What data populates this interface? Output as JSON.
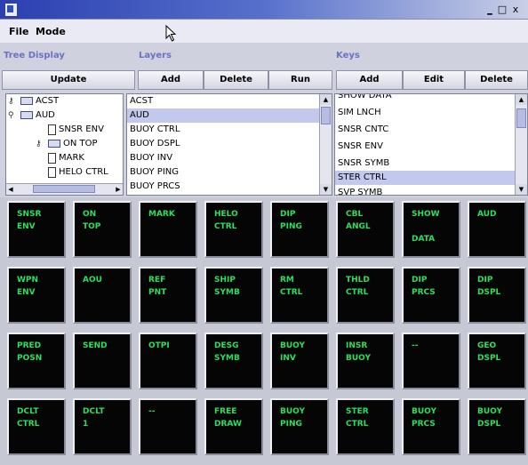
{
  "window": {
    "controls": {
      "minimize": "_",
      "maximize": "□",
      "close": "x"
    }
  },
  "menu": {
    "items": [
      "File",
      "Mode"
    ]
  },
  "sections": {
    "tree": "Tree Display",
    "layers": "Layers",
    "keys": "Keys"
  },
  "toolbar": {
    "update": "Update",
    "layers_add": "Add",
    "layers_delete": "Delete",
    "layers_run": "Run",
    "keys_add": "Add",
    "keys_edit": "Edit",
    "keys_delete": "Delete"
  },
  "tree": {
    "nodes": [
      {
        "label": "ACST",
        "icon": "folder",
        "expander": "key"
      },
      {
        "label": "AUD",
        "icon": "folder",
        "expander": "open"
      },
      {
        "label": "SNSR ENV",
        "icon": "document",
        "expander": ""
      },
      {
        "label": "ON TOP",
        "icon": "folder",
        "expander": "key"
      },
      {
        "label": "MARK",
        "icon": "document",
        "expander": ""
      },
      {
        "label": "HELO CTRL",
        "icon": "document",
        "expander": ""
      }
    ]
  },
  "layers": {
    "items": [
      "ACST",
      "AUD",
      "BUOY CTRL",
      "BUOY DSPL",
      "BUOY INV",
      "BUOY PING",
      "BUOY PRCS"
    ],
    "selected": "AUD"
  },
  "keys": {
    "items": [
      "SHOW DATA",
      "SIM LNCH",
      "SNSR CNTC",
      "SNSR ENV",
      "SNSR SYMB",
      "STER CTRL",
      "SVP SYMB"
    ],
    "selected": "STER CTRL"
  },
  "grid": {
    "text_color": "#2be05a",
    "buttons": [
      "SNSR\nENV",
      "ON\nTOP",
      "MARK",
      "HELO\nCTRL",
      "DIP\nPING",
      "CBL\nANGL",
      "SHOW\n\nDATA",
      "AUD",
      "WPN\nENV",
      "AOU",
      "REF\nPNT",
      "SHIP\nSYMB",
      "RM\nCTRL",
      "THLD\nCTRL",
      "DIP\nPRCS",
      "DIP\nDSPL",
      "PRED\nPOSN",
      "SEND",
      "OTPI",
      "DESG\nSYMB",
      "BUOY\nINV",
      "INSR\nBUOY",
      "--",
      "GEO\nDSPL",
      "DCLT\nCTRL",
      "DCLT\n1",
      "--",
      "FREE\nDRAW",
      "BUOY\nPING",
      "STER\nCTRL",
      "BUOY\nPRCS",
      "BUOY\nDSPL"
    ]
  }
}
